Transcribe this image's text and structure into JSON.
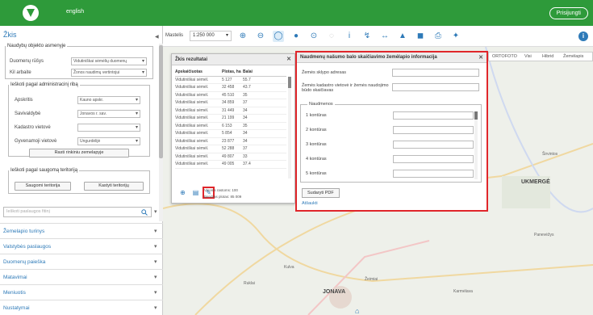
{
  "header": {
    "language": "english",
    "login_label": "Prisijungti"
  },
  "sidebar": {
    "title": "Žkis",
    "filter_group_legend": "Naudybų objekto asmenyje",
    "field1_label": "Duomenų rūšys",
    "field1_value": "Vidutiniškai sėmėlių duomenų",
    "field2_label": "Kil arbaite",
    "field2_value": "Žonos naudimų vertintojui",
    "admin_legend": "Ieškoti pagal administracinį ribą",
    "admin_rows": [
      {
        "label": "Apskritis",
        "value": "Kauno apskr."
      },
      {
        "label": "Savivaldybė",
        "value": "Jonavos r. sav."
      },
      {
        "label": "Kadastro vietovė",
        "value": ""
      },
      {
        "label": "Gyvenamoji vietovė",
        "value": "Ungurdėlijė"
      }
    ],
    "admin_button": "Rasti rinkiniu zemelapyje",
    "protect_legend": "Ieškoti pagal saugomą teritoriją",
    "protect_buttons": [
      "Saugomi teritorija",
      "Kastyti teritorijų"
    ],
    "search_placeholder": "Ieškoti paslaugos fitinį",
    "accordion": [
      "Žemelapio turinys",
      "Valstybės paslaugos",
      "Duomenų paieška",
      "Matavimai",
      "Meniuotis",
      "Nustatymai"
    ]
  },
  "toolbar": {
    "scale_label": "Mastelis",
    "scale_value": "1:250 000"
  },
  "layers_bar": {
    "items": [
      "ORTOFOTO",
      "Visi",
      "Hibrid",
      "Žemėlapis"
    ]
  },
  "table_panel": {
    "title": "Žkis rezultatai",
    "headers": [
      "Apskaičiuotas",
      "Plotas, ha",
      "Balai"
    ],
    "rows": [
      [
        "Vidutiniškai sėmėl.",
        "5 127",
        "55.7"
      ],
      [
        "Vidutiniškai sėmėl.",
        "32 458",
        "43.7"
      ],
      [
        "Vidutiniškai sėmėl.",
        "45 510",
        "35"
      ],
      [
        "Vidutiniškai sėmėl.",
        "34 859",
        "37"
      ],
      [
        "Vidutiniškai sėmėl.",
        "31 449",
        "34"
      ],
      [
        "Vidutiniškai sėmėl.",
        "21 199",
        "34"
      ],
      [
        "Vidutiniškai sėmėl.",
        "6 153",
        "35"
      ],
      [
        "Vidutiniškai sėmėl.",
        "5 854",
        "34"
      ],
      [
        "Vidutiniškai sėmėl.",
        "23 877",
        "34"
      ],
      [
        "Vidutiniškai sėmėl.",
        "52 288",
        "37"
      ],
      [
        "Vidutiniškai sėmėl.",
        "49 807",
        "33"
      ],
      [
        "Vidutiniškai sėmėl.",
        "49 005",
        "37.4"
      ]
    ],
    "note1": "Visoms rastoms: 100",
    "note2": "Bendras plotas: 85 009"
  },
  "dialog": {
    "title": "Naudmenų našumo balo skaičiavimo žemėlapio informacija",
    "field1_label": "Žemės sklypo adresas",
    "field2_label": "Žemės kadastro vietovė ir žemės naudojimo būdo skaičiavas",
    "naudmenos_legend": "Naudmenos",
    "naud_rows": [
      "1 kontūras",
      "2 kontūras",
      "3 kontūras",
      "4 kontūras",
      "5 kontūras"
    ],
    "pdf_button": "Sudaryti PDF",
    "close_link": "Atšaukti"
  },
  "map": {
    "labels": [
      "JONAVA",
      "UKMERGĖ",
      "Širvintos",
      "Ruklai",
      "Kulva",
      "Žeimiai",
      "Panevėžys",
      "Karmėlava"
    ]
  }
}
